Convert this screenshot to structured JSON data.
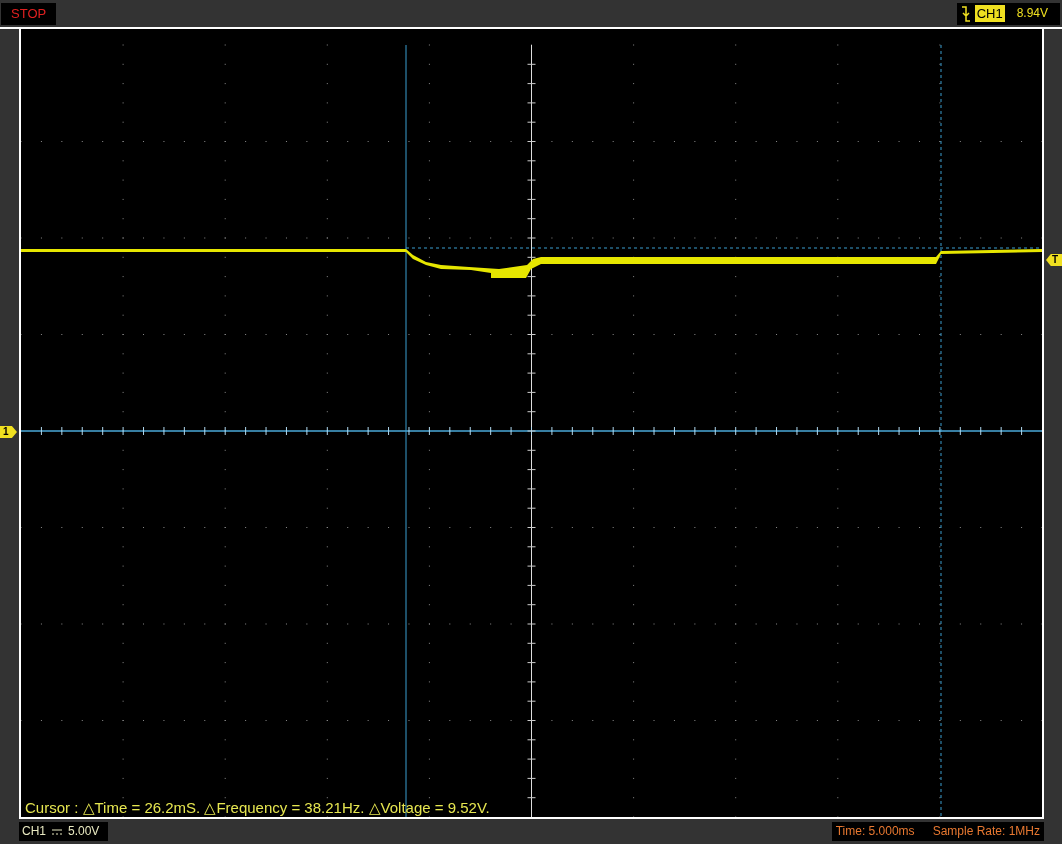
{
  "status": "STOP",
  "trigger": {
    "channel": "CH1",
    "level": "8.94V"
  },
  "channel_marker": "1",
  "trigger_marker": "T",
  "cursor_readout": "Cursor : △Time = 26.2mS. △Frequency = 38.21Hz. △Voltage = 9.52V.",
  "bottom_bar": {
    "channel": "CH1",
    "scale": "5.00V",
    "time": "Time: 5.000ms",
    "sample_rate": "Sample Rate: 1MHz"
  }
}
